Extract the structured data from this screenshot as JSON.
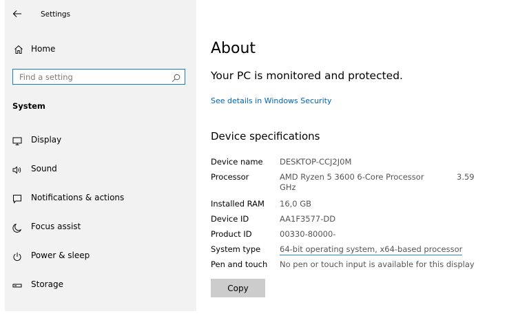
{
  "titlebar": {
    "title": "Settings",
    "back_icon": "arrow-left-icon"
  },
  "sidebar": {
    "home_label": "Home",
    "home_icon": "home-icon",
    "search": {
      "placeholder": "Find a setting",
      "value": "",
      "icon": "search-icon"
    },
    "section_header": "System",
    "items": [
      {
        "label": "Display",
        "icon": "monitor-icon"
      },
      {
        "label": "Sound",
        "icon": "speaker-icon"
      },
      {
        "label": "Notifications & actions",
        "icon": "notification-icon"
      },
      {
        "label": "Focus assist",
        "icon": "moon-icon"
      },
      {
        "label": "Power & sleep",
        "icon": "power-icon"
      },
      {
        "label": "Storage",
        "icon": "storage-icon"
      }
    ]
  },
  "main": {
    "title": "About",
    "protection_status": "Your PC is monitored and protected.",
    "security_link": "See details in Windows Security",
    "specs_title": "Device specifications",
    "specs": [
      {
        "label": "Device name",
        "value": "DESKTOP-CCJ2J0M"
      },
      {
        "label": "Processor",
        "value": "AMD Ryzen 5 3600 6-Core Processor",
        "value_extra": "3.59",
        "value_line2": "GHz"
      },
      {
        "label": "Installed RAM",
        "value": "16,0 GB"
      },
      {
        "label": "Device ID",
        "value": "AA1F3577-DD"
      },
      {
        "label": "Product ID",
        "value": "00330-80000-"
      },
      {
        "label": "System type",
        "value": "64-bit operating system, x64-based processor"
      },
      {
        "label": "Pen and touch",
        "value": "No pen or touch input is available for this display"
      }
    ],
    "copy_label": "Copy"
  },
  "colors": {
    "sidebar_bg": "#f2f2f2",
    "accent": "#0063b1",
    "search_border": "#1a7ad4",
    "button_bg": "#cccccc"
  }
}
